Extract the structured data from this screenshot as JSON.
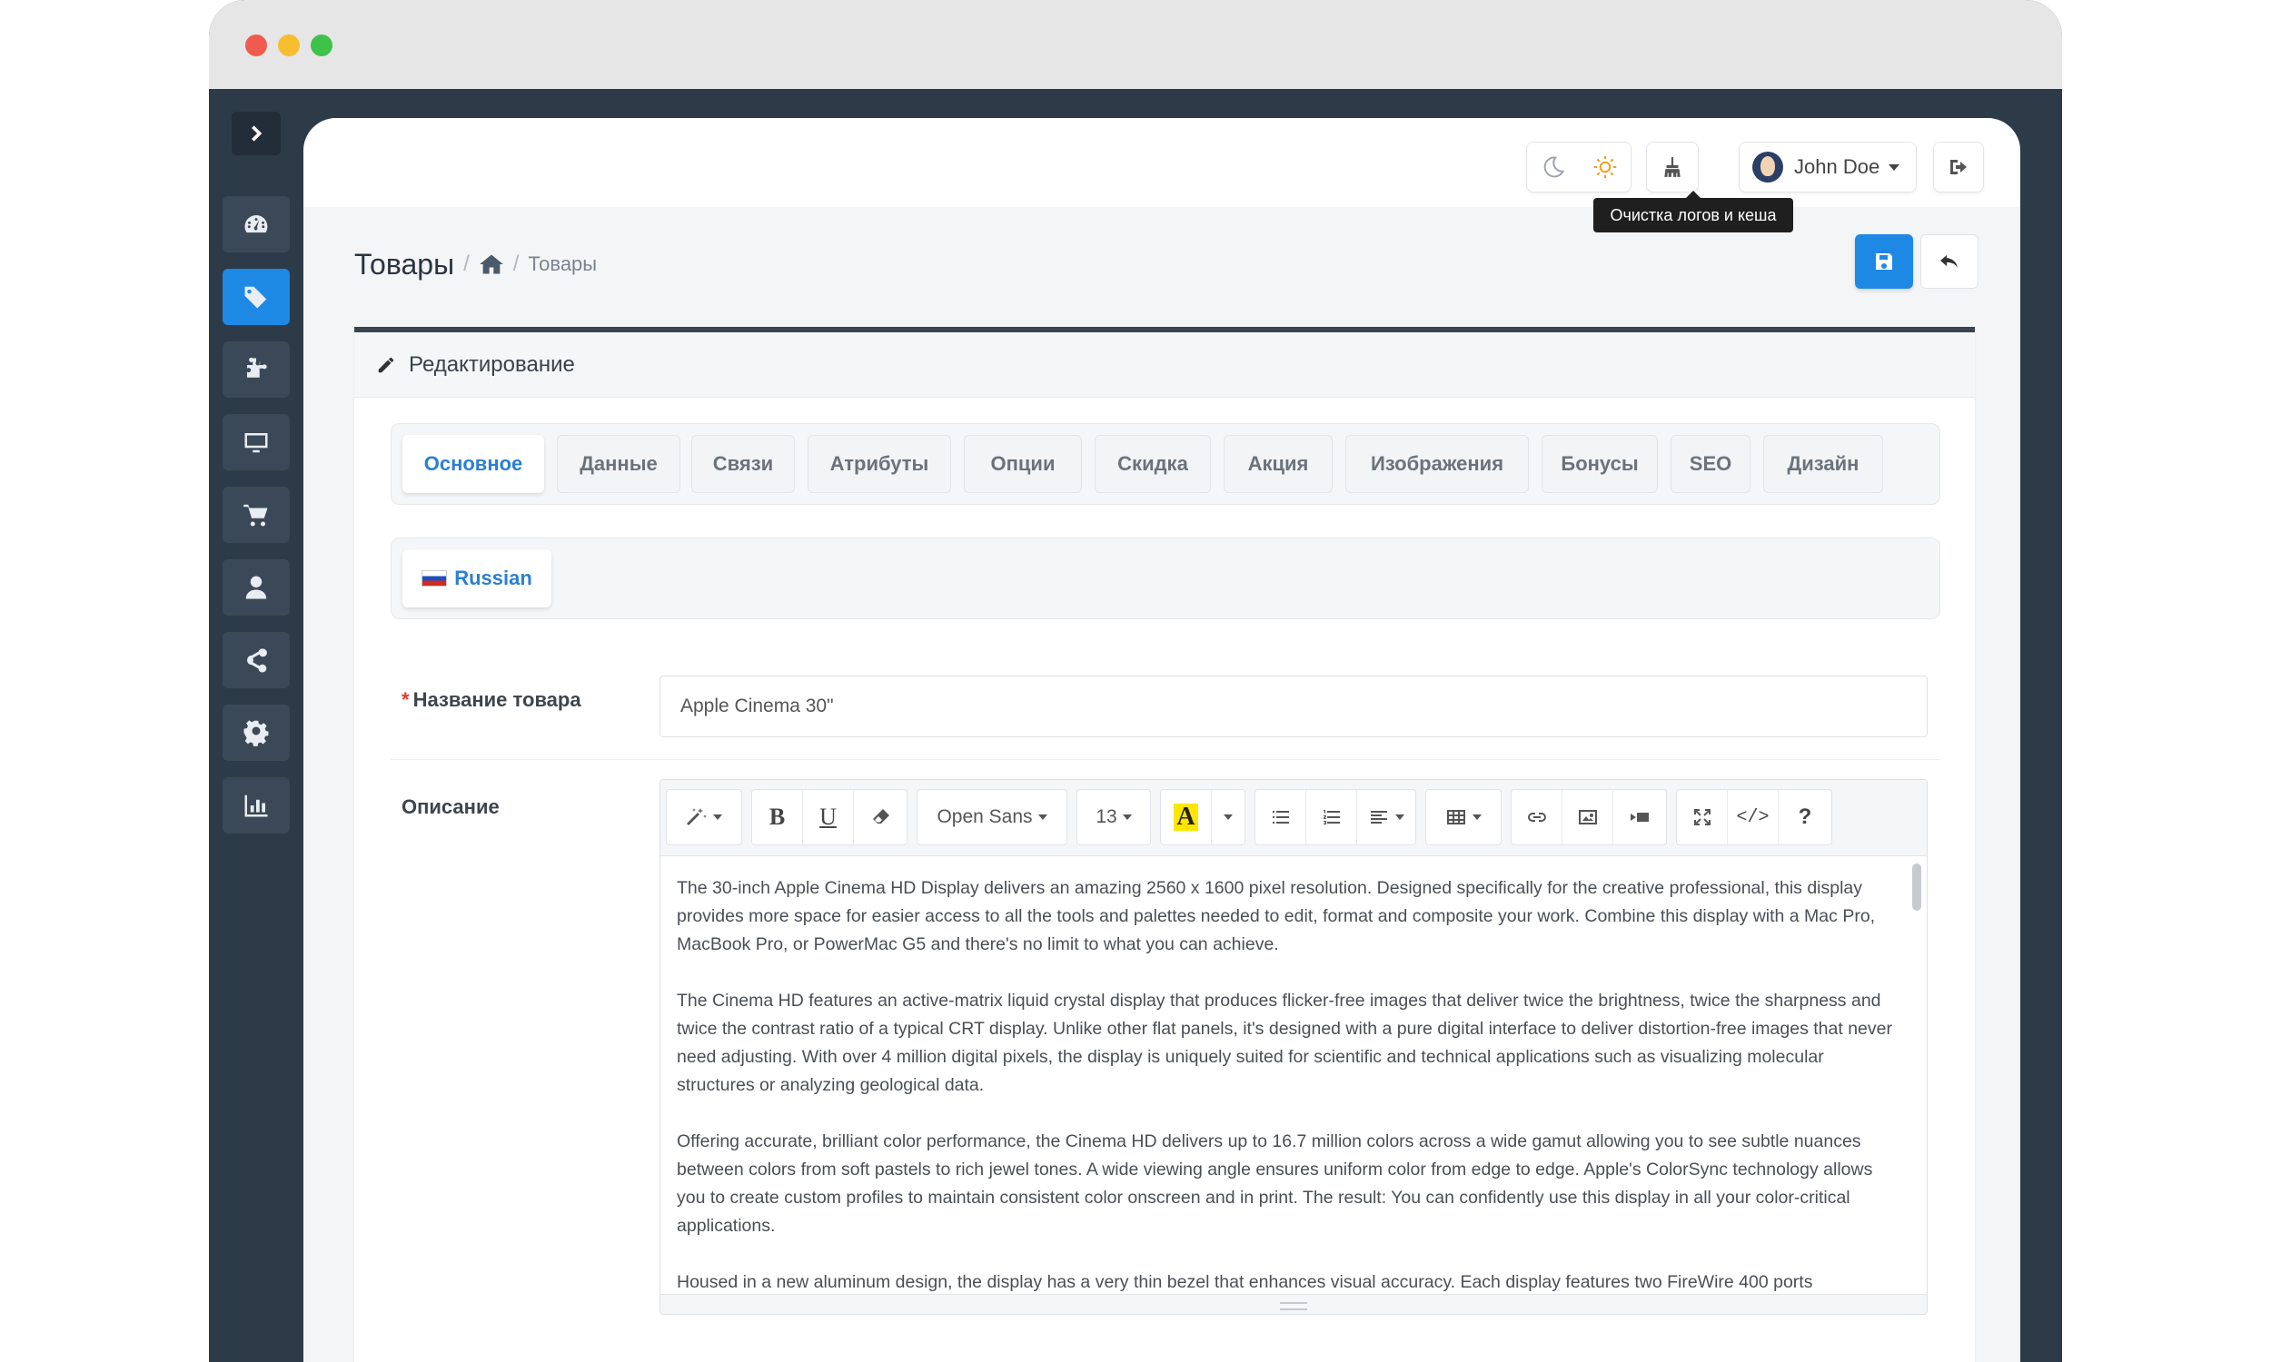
{
  "topbar": {
    "user_name": "John Doe",
    "tooltip": "Очистка логов и кеша"
  },
  "breadcrumb": {
    "title": "Товары",
    "current": "Товары"
  },
  "card": {
    "title": "Редактирование"
  },
  "tabs": [
    {
      "label": "Основное",
      "active": true
    },
    {
      "label": "Данные",
      "active": false
    },
    {
      "label": "Связи",
      "active": false
    },
    {
      "label": "Атрибуты",
      "active": false
    },
    {
      "label": "Опции",
      "active": false
    },
    {
      "label": "Скидка",
      "active": false
    },
    {
      "label": "Акция",
      "active": false
    },
    {
      "label": "Изображения",
      "active": false
    },
    {
      "label": "Бонусы",
      "active": false
    },
    {
      "label": "SEO",
      "active": false
    },
    {
      "label": "Дизайн",
      "active": false
    }
  ],
  "language": {
    "label": "Russian"
  },
  "form": {
    "name_label": "Название товара",
    "name_value": "Apple Cinema 30\"",
    "description_label": "Описание"
  },
  "editor": {
    "font": "Open Sans",
    "size": "13",
    "paragraphs": [
      "The 30-inch Apple Cinema HD Display delivers an amazing 2560 x 1600 pixel resolution. Designed specifically for the creative professional, this display provides more space for easier access to all the tools and palettes needed to edit, format and composite your work. Combine this display with a Mac Pro, MacBook Pro, or PowerMac G5 and there's no limit to what you can achieve.",
      "The Cinema HD features an active-matrix liquid crystal display that produces flicker-free images that deliver twice the brightness, twice the sharpness and twice the contrast ratio of a typical CRT display. Unlike other flat panels, it's designed with a pure digital interface to deliver distortion-free images that never need adjusting. With over 4 million digital pixels, the display is uniquely suited for scientific and technical applications such as visualizing molecular structures or analyzing geological data.",
      "Offering accurate, brilliant color performance, the Cinema HD delivers up to 16.7 million colors across a wide gamut allowing you to see subtle nuances between colors from soft pastels to rich jewel tones. A wide viewing angle ensures uniform color from edge to edge. Apple's ColorSync technology allows you to create custom profiles to maintain consistent color onscreen and in print. The result: You can confidently use this display in all your color-critical applications.",
      "Housed in a new aluminum design, the display has a very thin bezel that enhances visual accuracy. Each display features two FireWire 400 ports"
    ]
  },
  "colors": {
    "accent": "#1e88e5",
    "sidebar": "#2d3a48",
    "required": "#e53935"
  }
}
